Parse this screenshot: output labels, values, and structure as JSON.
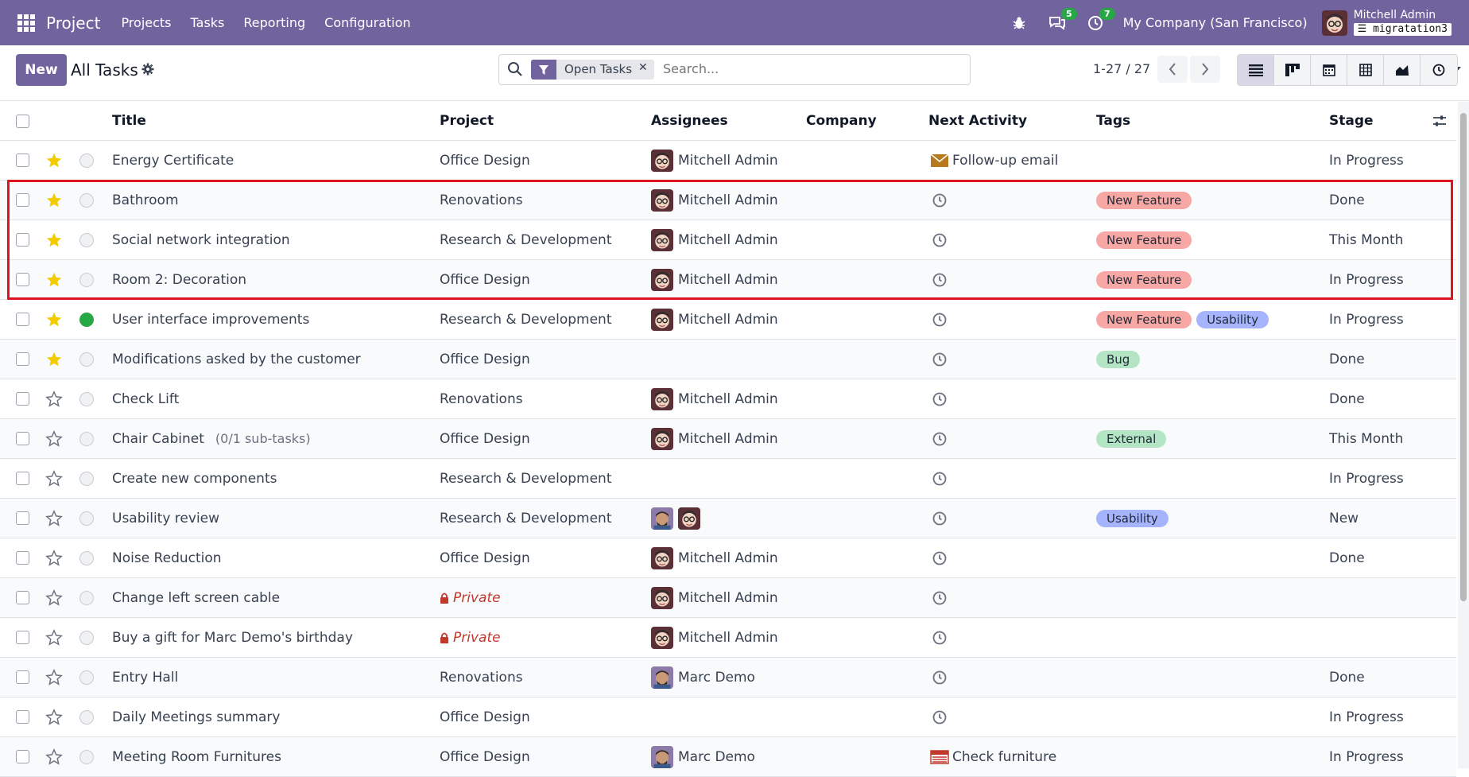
{
  "navbar": {
    "app_name": "Project",
    "menu": [
      "Projects",
      "Tasks",
      "Reporting",
      "Configuration"
    ],
    "messages_count": "5",
    "activities_count": "7",
    "company": "My Company (San Francisco)",
    "user_name": "Mitchell Admin",
    "database": "migratation3"
  },
  "control": {
    "new_label": "New",
    "title": "All Tasks",
    "filter_facet": "Open Tasks",
    "search_placeholder": "Search...",
    "pager": "1-27 / 27"
  },
  "table": {
    "columns": [
      "Title",
      "Project",
      "Assignees",
      "Company",
      "Next Activity",
      "Tags",
      "Stage"
    ],
    "rows": [
      {
        "starred": true,
        "state": "normal",
        "title": "Energy Certificate",
        "subtasks": "",
        "project": "Office Design",
        "private": false,
        "assignees": [
          "Mitchell Admin"
        ],
        "assignee_label": "Mitchell Admin",
        "activity": "Follow-up email",
        "activity_icon": "envelope-icon",
        "tags": [],
        "stage": "In Progress"
      },
      {
        "starred": true,
        "state": "normal",
        "title": "Bathroom",
        "subtasks": "",
        "project": "Renovations",
        "private": false,
        "assignees": [
          "Mitchell Admin"
        ],
        "assignee_label": "Mitchell Admin",
        "activity": "",
        "activity_icon": "clock-icon",
        "tags": [
          {
            "label": "New Feature",
            "color": "red"
          }
        ],
        "stage": "Done"
      },
      {
        "starred": true,
        "state": "normal",
        "title": "Social network integration",
        "subtasks": "",
        "project": "Research & Development",
        "private": false,
        "assignees": [
          "Mitchell Admin"
        ],
        "assignee_label": "Mitchell Admin",
        "activity": "",
        "activity_icon": "clock-icon",
        "tags": [
          {
            "label": "New Feature",
            "color": "red"
          }
        ],
        "stage": "This Month"
      },
      {
        "starred": true,
        "state": "normal",
        "title": "Room 2: Decoration",
        "subtasks": "",
        "project": "Office Design",
        "private": false,
        "assignees": [
          "Mitchell Admin"
        ],
        "assignee_label": "Mitchell Admin",
        "activity": "",
        "activity_icon": "clock-icon",
        "tags": [
          {
            "label": "New Feature",
            "color": "red"
          }
        ],
        "stage": "In Progress"
      },
      {
        "starred": true,
        "state": "done",
        "title": "User interface improvements",
        "subtasks": "",
        "project": "Research & Development",
        "private": false,
        "assignees": [
          "Mitchell Admin"
        ],
        "assignee_label": "Mitchell Admin",
        "activity": "",
        "activity_icon": "clock-icon",
        "tags": [
          {
            "label": "New Feature",
            "color": "red"
          },
          {
            "label": "Usability",
            "color": "blue"
          }
        ],
        "stage": "In Progress"
      },
      {
        "starred": true,
        "state": "normal",
        "title": "Modifications asked by the customer",
        "subtasks": "",
        "project": "Office Design",
        "private": false,
        "assignees": [],
        "assignee_label": "",
        "activity": "",
        "activity_icon": "clock-icon",
        "tags": [
          {
            "label": "Bug",
            "color": "green"
          }
        ],
        "stage": "Done"
      },
      {
        "starred": false,
        "state": "normal",
        "title": "Check Lift",
        "subtasks": "",
        "project": "Renovations",
        "private": false,
        "assignees": [
          "Mitchell Admin"
        ],
        "assignee_label": "Mitchell Admin",
        "activity": "",
        "activity_icon": "clock-icon",
        "tags": [],
        "stage": "Done"
      },
      {
        "starred": false,
        "state": "normal",
        "title": "Chair Cabinet",
        "subtasks": "(0/1 sub-tasks)",
        "project": "Office Design",
        "private": false,
        "assignees": [
          "Mitchell Admin"
        ],
        "assignee_label": "Mitchell Admin",
        "activity": "",
        "activity_icon": "clock-icon",
        "tags": [
          {
            "label": "External",
            "color": "green"
          }
        ],
        "stage": "This Month"
      },
      {
        "starred": false,
        "state": "normal",
        "title": "Create new components",
        "subtasks": "",
        "project": "Research & Development",
        "private": false,
        "assignees": [],
        "assignee_label": "",
        "activity": "",
        "activity_icon": "clock-icon",
        "tags": [],
        "stage": "In Progress"
      },
      {
        "starred": false,
        "state": "normal",
        "title": "Usability review",
        "subtasks": "",
        "project": "Research & Development",
        "private": false,
        "assignees": [
          "Marc Demo",
          "Mitchell Admin"
        ],
        "assignee_label": "",
        "activity": "",
        "activity_icon": "clock-icon",
        "tags": [
          {
            "label": "Usability",
            "color": "blue"
          }
        ],
        "stage": "New"
      },
      {
        "starred": false,
        "state": "normal",
        "title": "Noise Reduction",
        "subtasks": "",
        "project": "Office Design",
        "private": false,
        "assignees": [
          "Mitchell Admin"
        ],
        "assignee_label": "Mitchell Admin",
        "activity": "",
        "activity_icon": "clock-icon",
        "tags": [],
        "stage": "Done"
      },
      {
        "starred": false,
        "state": "normal",
        "title": "Change left screen cable",
        "subtasks": "",
        "project": "Private",
        "private": true,
        "assignees": [
          "Mitchell Admin"
        ],
        "assignee_label": "Mitchell Admin",
        "activity": "",
        "activity_icon": "clock-icon",
        "tags": [],
        "stage": ""
      },
      {
        "starred": false,
        "state": "normal",
        "title": "Buy a gift for Marc Demo's birthday",
        "subtasks": "",
        "project": "Private",
        "private": true,
        "assignees": [
          "Mitchell Admin"
        ],
        "assignee_label": "Mitchell Admin",
        "activity": "",
        "activity_icon": "clock-icon",
        "tags": [],
        "stage": ""
      },
      {
        "starred": false,
        "state": "normal",
        "title": "Entry Hall",
        "subtasks": "",
        "project": "Renovations",
        "private": false,
        "assignees": [
          "Marc Demo"
        ],
        "assignee_label": "Marc Demo",
        "activity": "",
        "activity_icon": "clock-icon",
        "tags": [],
        "stage": "Done"
      },
      {
        "starred": false,
        "state": "normal",
        "title": "Daily Meetings summary",
        "subtasks": "",
        "project": "Office Design",
        "private": false,
        "assignees": [],
        "assignee_label": "",
        "activity": "",
        "activity_icon": "clock-icon",
        "tags": [],
        "stage": "In Progress"
      },
      {
        "starred": false,
        "state": "normal",
        "title": "Meeting Room Furnitures",
        "subtasks": "",
        "project": "Office Design",
        "private": false,
        "assignees": [
          "Marc Demo"
        ],
        "assignee_label": "Marc Demo",
        "activity": "Check furniture",
        "activity_icon": "calendar-icon",
        "tags": [],
        "stage": "In Progress"
      }
    ]
  },
  "colors": {
    "brand": "#71639e",
    "star": "#f3cc00",
    "highlight": "#e0121f",
    "tag_red": "#f7a8a4",
    "tag_blue": "#a5b4fc",
    "tag_green": "#b3e5c5"
  }
}
